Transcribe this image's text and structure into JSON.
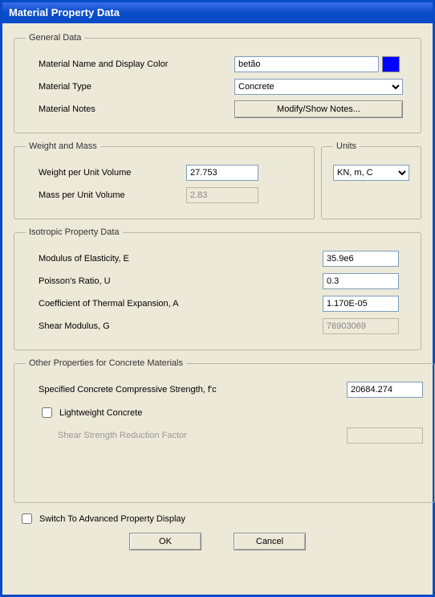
{
  "window": {
    "title": "Material Property Data"
  },
  "general": {
    "legend": "General Data",
    "name_label": "Material Name and Display Color",
    "name_value": "betão",
    "color": "#0000ff",
    "type_label": "Material Type",
    "type_value": "Concrete",
    "notes_label": "Material Notes",
    "notes_button": "Modify/Show Notes..."
  },
  "weightmass": {
    "legend": "Weight and Mass",
    "weight_label": "Weight per Unit Volume",
    "weight_value": "27.753",
    "mass_label": "Mass per Unit Volume",
    "mass_value": "2.83"
  },
  "units": {
    "legend": "Units",
    "value": "KN, m, C"
  },
  "iso": {
    "legend": "Isotropic Property Data",
    "e_label": "Modulus of Elasticity,  E",
    "e_value": "35.9e6",
    "u_label": "Poisson's Ratio,  U",
    "u_value": "0.3",
    "a_label": "Coefficient of Thermal Expansion,  A",
    "a_value": "1.170E-05",
    "g_label": "Shear Modulus,  G",
    "g_value": "76903069"
  },
  "other": {
    "legend": "Other Properties for Concrete Materials",
    "fc_label": "Specified Concrete Compressive Strength, f'c",
    "fc_value": "20684.274",
    "lw_label": "Lightweight Concrete",
    "ssrf_label": "Shear Strength Reduction Factor"
  },
  "bottom": {
    "switch_label": "Switch To Advanced Property Display",
    "ok": "OK",
    "cancel": "Cancel"
  }
}
